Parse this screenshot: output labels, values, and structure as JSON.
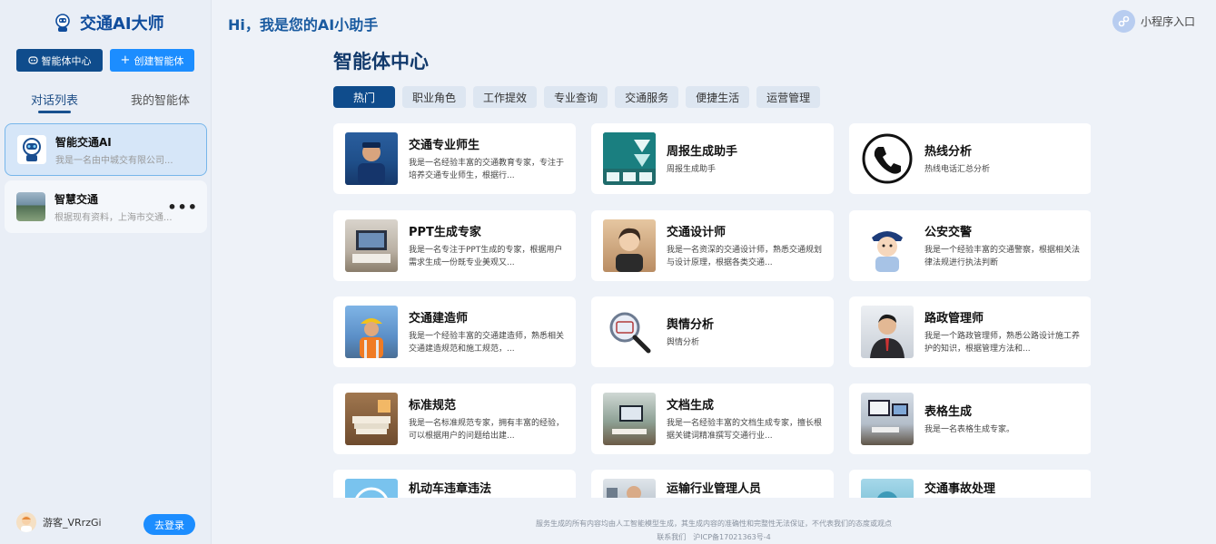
{
  "sidebar": {
    "logo_text": "交通AI大师",
    "btn_agent_center": "智能体中心",
    "btn_create_agent": "创建智能体",
    "tabs": [
      "对话列表",
      "我的智能体"
    ],
    "conversations": [
      {
        "title": "智能交通AI",
        "subtitle": "我是一名由中城交有限公司..."
      },
      {
        "title": "智慧交通",
        "subtitle": "根据现有资料，上海市交通..."
      }
    ],
    "user_name": "游客_VRrzGi",
    "login_label": "去登录"
  },
  "header": {
    "greeting": "Hi，我是您的AI小助手",
    "mini_program": "小程序入口"
  },
  "main": {
    "title": "智能体中心",
    "tabs": [
      "热门",
      "职业角色",
      "工作提效",
      "专业查询",
      "交通服务",
      "便捷生活",
      "运营管理"
    ],
    "cards": [
      {
        "title": "交通专业师生",
        "desc": "我是一名经验丰富的交通教育专家，专注于培养交通专业师生，根据行..."
      },
      {
        "title": "周报生成助手",
        "desc": "周报生成助手"
      },
      {
        "title": "热线分析",
        "desc": "热线电话汇总分析"
      },
      {
        "title": "PPT生成专家",
        "desc": "我是一名专注于PPT生成的专家，根据用户需求生成一份既专业美观又..."
      },
      {
        "title": "交通设计师",
        "desc": "我是一名资深的交通设计师，熟悉交通规划与设计原理，根据各类交通..."
      },
      {
        "title": "公安交警",
        "desc": "我是一个经验丰富的交通警察，根据相关法律法规进行执法判断"
      },
      {
        "title": "交通建造师",
        "desc": "我是一个经验丰富的交通建造师，熟悉相关交通建造规范和施工规范，..."
      },
      {
        "title": "舆情分析",
        "desc": "舆情分析"
      },
      {
        "title": "路政管理师",
        "desc": "我是一个路政管理师，熟悉公路设计施工养护的知识，根据管理方法和..."
      },
      {
        "title": "标准规范",
        "desc": "我是一名标准规范专家，拥有丰富的经验，可以根据用户的问题给出建..."
      },
      {
        "title": "文档生成",
        "desc": "我是一名经验丰富的文档生成专家，擅长根据关键词精准撰写交通行业..."
      },
      {
        "title": "表格生成",
        "desc": "我是一名表格生成专家。"
      },
      {
        "title": "机动车违章违法",
        "desc": ""
      },
      {
        "title": "运输行业管理人员",
        "desc": ""
      },
      {
        "title": "交通事故处理",
        "desc": ""
      }
    ]
  },
  "footer": {
    "line1": "服务生成的所有内容均由人工智能模型生成，其生成内容的准确性和完整性无法保证，不代表我们的态度或观点",
    "line2": "联系我们　沪ICP备17021363号-4"
  },
  "icons": [
    "robot-icon",
    "plus-icon",
    "more-icon",
    "link-icon",
    "phone-icon",
    "magnifier-icon"
  ],
  "colors": {
    "primary": "#0f4c8c",
    "accent": "#1c8dff",
    "background": "#eef2f8"
  }
}
